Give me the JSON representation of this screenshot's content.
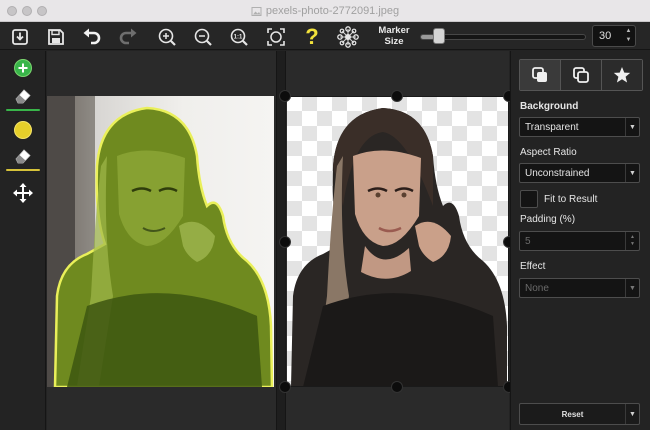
{
  "window": {
    "title": "pexels-photo-2772091.jpeg"
  },
  "toolbar": {
    "buttons": [
      {
        "name": "import-button",
        "icon": "import-icon"
      },
      {
        "name": "save-button",
        "icon": "save-icon"
      },
      {
        "name": "undo-button",
        "icon": "undo-icon"
      },
      {
        "name": "redo-button",
        "icon": "redo-icon"
      },
      {
        "name": "zoom-in-button",
        "icon": "zoom-in-icon"
      },
      {
        "name": "zoom-out-button",
        "icon": "zoom-out-icon"
      },
      {
        "name": "zoom-actual-button",
        "icon": "zoom-1-1-icon"
      },
      {
        "name": "zoom-fit-button",
        "icon": "zoom-fit-icon"
      },
      {
        "name": "help-button",
        "icon": "help-icon"
      },
      {
        "name": "network-button",
        "icon": "network-icon"
      }
    ],
    "zoom_actual_text": "1:1",
    "help_text": "?",
    "marker_label_line1": "Marker",
    "marker_label_line2": "Size",
    "marker_size": "30",
    "marker_level_fraction": 0.08
  },
  "left_tools": [
    {
      "name": "keep-marker-tool",
      "icon": "plus-circle-icon"
    },
    {
      "name": "keep-eraser-tool",
      "icon": "eraser-icon"
    },
    {
      "name": "remove-marker-tool",
      "icon": "yellow-circle-icon"
    },
    {
      "name": "remove-eraser-tool",
      "icon": "eraser-icon"
    },
    {
      "name": "pan-tool",
      "icon": "move-arrows-icon"
    }
  ],
  "sidebar": {
    "tabs": [
      {
        "name": "tab-background",
        "icon": "layers-icon",
        "active": true
      },
      {
        "name": "tab-shadow",
        "icon": "copy-layers-icon",
        "active": false
      },
      {
        "name": "tab-effects",
        "icon": "star-icon",
        "active": false
      }
    ],
    "background_label": "Background",
    "background_value": "Transparent",
    "aspect_label": "Aspect Ratio",
    "aspect_value": "Unconstrained",
    "fit_label": "Fit to Result",
    "padding_label": "Padding (%)",
    "padding_value": "5",
    "effect_label": "Effect",
    "effect_value": "None",
    "reset_label": "Reset"
  },
  "colors": {
    "accent_yellow": "#f2e23b",
    "add_green": "#39b54a",
    "highlight_green": "#8fd13a"
  }
}
